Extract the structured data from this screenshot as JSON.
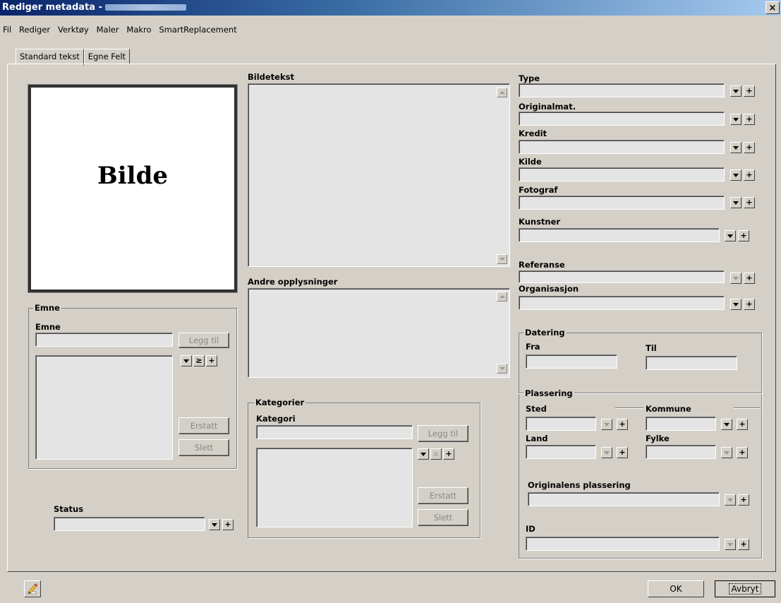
{
  "window": {
    "title": "Rediger metadata -"
  },
  "menu": [
    "Fil",
    "Rediger",
    "Verktøy",
    "Maler",
    "Makro",
    "SmartReplacement"
  ],
  "tabs": [
    "Standard tekst",
    "Egne Felt"
  ],
  "image_placeholder": "Bilde",
  "caption": {
    "label": "Bildetekst"
  },
  "other_info": {
    "label": "Andre opplysninger"
  },
  "right_fields": {
    "type": "Type",
    "originalmat": "Originalmat.",
    "kredit": "Kredit",
    "kilde": "Kilde",
    "fotograf": "Fotograf",
    "kunstner": "Kunstner",
    "referanse": "Referanse",
    "organisasjon": "Organisasjon"
  },
  "emne": {
    "group_label": "Emne",
    "field_label": "Emne",
    "add_button": "Legg til",
    "replace_button": "Erstatt",
    "delete_button": "Slett"
  },
  "kategorier": {
    "group_label": "Kategorier",
    "field_label": "Kategori",
    "add_button": "Legg til",
    "replace_button": "Erstatt",
    "delete_button": "Slett"
  },
  "status": {
    "label": "Status"
  },
  "datering": {
    "group_label": "Datering",
    "from_label": "Fra",
    "to_label": "Til"
  },
  "plassering": {
    "group_label": "Plassering",
    "sted": "Sted",
    "kommune": "Kommune",
    "land": "Land",
    "fylke": "Fylke"
  },
  "originalens_plassering": {
    "label": "Originalens plassering"
  },
  "id": {
    "label": "ID"
  },
  "buttons": {
    "ok": "OK",
    "cancel": "Avbryt"
  },
  "icons": {
    "plus": "+",
    "sort": "≥",
    "dropdown": "chevron-down-icon",
    "pencil": "pencil-icon",
    "close": "×"
  },
  "colors": {
    "window_bg": "#d4d0c8",
    "title_start": "#0a246a",
    "title_end": "#a6caf0",
    "field_bg": "#e4e4e4"
  }
}
